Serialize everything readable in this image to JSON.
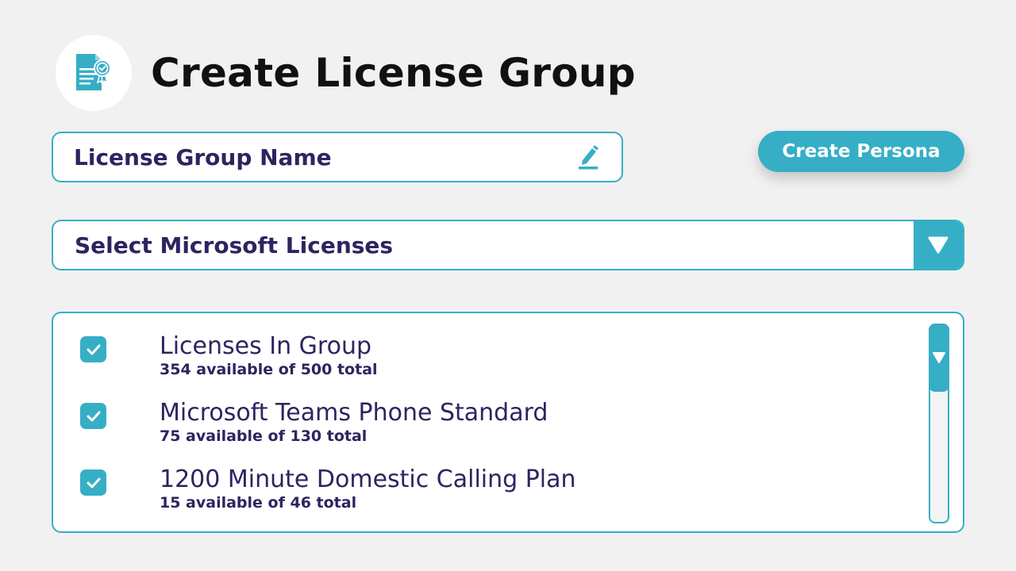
{
  "header": {
    "title": "Create License Group",
    "icon": "license-certificate-icon"
  },
  "name_field": {
    "value": "License Group Name",
    "icon": "pencil-edit-icon"
  },
  "actions": {
    "create_persona_label": "Create Persona"
  },
  "license_select": {
    "value": "Select Microsoft Licenses",
    "icon": "triangle-down-icon"
  },
  "license_list": {
    "items": [
      {
        "name": "Licenses In Group",
        "availability": "354 available of 500 total",
        "checked": true
      },
      {
        "name": "Microsoft Teams Phone Standard",
        "availability": "75 available of 130 total",
        "checked": true
      },
      {
        "name": "1200 Minute Domestic Calling Plan",
        "availability": "15 available of 46 total",
        "checked": true
      }
    ]
  },
  "colors": {
    "accent": "#36aec6",
    "text": "#2b2560",
    "background": "#f1f1f1",
    "title": "#111111"
  }
}
